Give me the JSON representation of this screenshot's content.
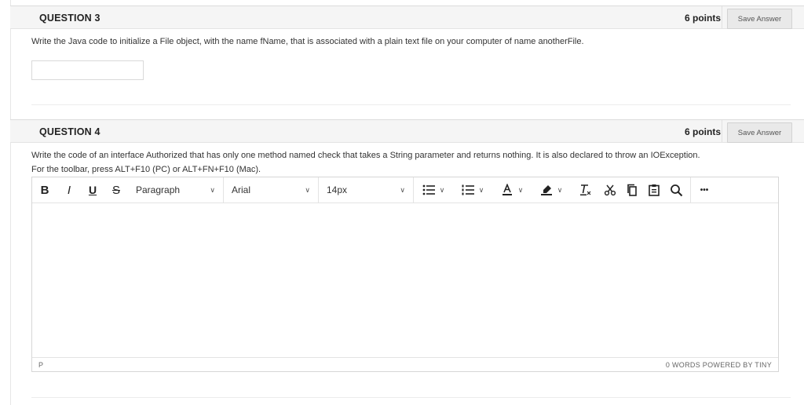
{
  "questions": [
    {
      "title": "QUESTION 3",
      "points": "6 points",
      "save_label": "Save Answer",
      "text": "Write the Java code to initialize a File object, with the  name fName, that is associated with a plain text file on your computer of name anotherFile.",
      "answer_value": ""
    },
    {
      "title": "QUESTION 4",
      "points": "6 points",
      "save_label": "Save Answer",
      "text": "Write the code of an interface Authorized that has only one method named check that takes a String parameter and returns nothing.  It is also declared to throw an IOException.",
      "toolbar_hint": "For the toolbar, press ALT+F10 (PC) or ALT+FN+F10 (Mac)."
    }
  ],
  "editor": {
    "toolbar": {
      "bold": "B",
      "italic": "I",
      "underline": "U",
      "strikethrough": "S",
      "block_format": "Paragraph",
      "font_family": "Arial",
      "font_size": "14px",
      "more": "•••"
    },
    "status_path": "P",
    "status_right": "0 WORDS  POWERED BY TINY"
  },
  "icons": {
    "bullet_list": "bullet-list-icon",
    "numbered_list": "numbered-list-icon",
    "text_color": "text-color-icon",
    "highlight": "highlight-icon",
    "clear_format": "clear-format-icon",
    "cut": "cut-icon",
    "copy": "copy-icon",
    "paste": "paste-icon",
    "search": "search-icon"
  }
}
